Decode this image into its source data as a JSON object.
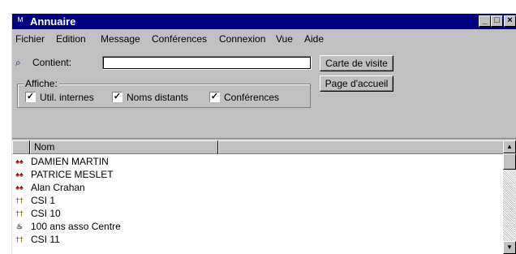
{
  "window": {
    "title": "Annuaire",
    "icon": "app-icon",
    "controls": {
      "minimize": "_",
      "maximize": "□",
      "close": "×"
    }
  },
  "menu": [
    {
      "label": "Fichier"
    },
    {
      "label": "Edition"
    },
    {
      "label": "Message"
    },
    {
      "label": "Conférences"
    },
    {
      "label": "Connexion"
    },
    {
      "label": "Vue"
    },
    {
      "label": "Aide"
    }
  ],
  "search": {
    "label": "Contient:",
    "value": "",
    "icon": "search-icon"
  },
  "buttons": {
    "business_card": "Carte de visite",
    "home_page": "Page d'accueil"
  },
  "display": {
    "legend": "Affiche:",
    "options": [
      {
        "label": "Util. internes",
        "checked": true
      },
      {
        "label": "Noms distants",
        "checked": true
      },
      {
        "label": "Conférences",
        "checked": true
      }
    ]
  },
  "list": {
    "columns": [
      "Nom",
      ""
    ],
    "rows": [
      {
        "name": "DAMIEN MARTIN",
        "icon": "users-group-icon",
        "color": "#a00000"
      },
      {
        "name": "PATRICE MESLET",
        "icon": "users-group-icon",
        "color": "#a00000"
      },
      {
        "name": "Alan Crahan",
        "icon": "users-group-icon",
        "color": "#a00000"
      },
      {
        "name": "CSI 1",
        "icon": "user-pair-icon",
        "color": "#806000"
      },
      {
        "name": "CSI 10",
        "icon": "user-pair-icon",
        "color": "#806000"
      },
      {
        "name": "100 ans asso Centre",
        "icon": "conference-icon",
        "color": "#404040"
      },
      {
        "name": "CSI 11",
        "icon": "user-pair-icon",
        "color": "#806000"
      }
    ]
  },
  "colors": {
    "titlebar": "#000080",
    "face": "#c0c0c0"
  }
}
